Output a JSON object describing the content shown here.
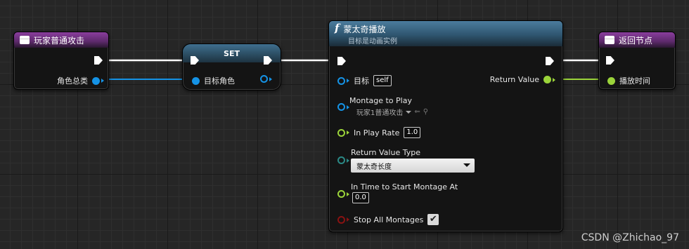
{
  "nodes": {
    "left_event": {
      "title": "玩家普通攻击",
      "output_label": "角色总类"
    },
    "set_node": {
      "title": "SET",
      "input_label": "目标角色"
    },
    "montage_node": {
      "title": "蒙太奇播放",
      "subtitle": "目标是动画实例",
      "target_label": "目标",
      "target_value": "self",
      "montage_label": "Montage to Play",
      "montage_asset": "玩家1普通攻击",
      "play_rate_label": "In Play Rate",
      "play_rate_value": "1.0",
      "return_type_label": "Return Value Type",
      "return_type_value": "蒙太奇长度",
      "start_time_label": "In Time to Start Montage At",
      "start_time_value": "0.0",
      "stop_all_label": "Stop All Montages",
      "stop_all_checked": true,
      "return_value_label": "Return Value"
    },
    "return_node": {
      "title": "返回节点",
      "input_label": "播放时间"
    }
  },
  "icons": {
    "event": "event-icon",
    "function": "function-icon",
    "check": "✔",
    "f": "f"
  },
  "colors": {
    "exec": "#ffffff",
    "object_pin": "#1593e6",
    "float_pin": "#9bd43a",
    "enum_pin": "#2b8a86",
    "bool_pin": "#8a1212",
    "event_header": "#8a3d9e",
    "function_header": "#4b7c9d"
  },
  "watermark": "CSDN @Zhichao_97"
}
